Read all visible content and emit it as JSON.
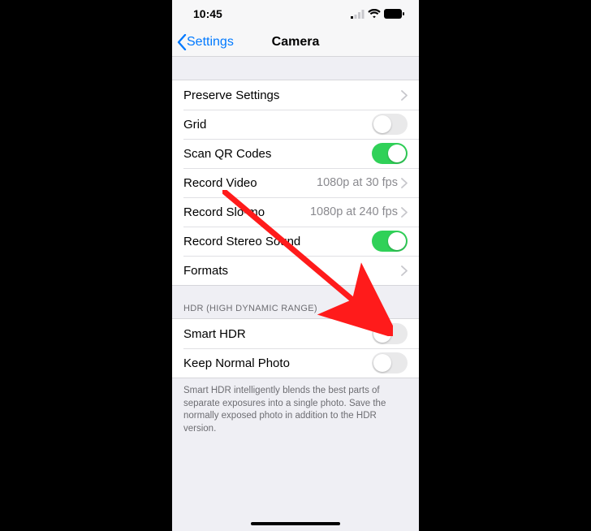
{
  "status": {
    "time": "10:45"
  },
  "nav": {
    "back_label": "Settings",
    "title": "Camera"
  },
  "group1": {
    "preserve_settings": "Preserve Settings",
    "grid": {
      "label": "Grid",
      "on": false
    },
    "scan_qr": {
      "label": "Scan QR Codes",
      "on": true
    },
    "record_video": {
      "label": "Record Video",
      "value": "1080p at 30 fps"
    },
    "record_slomo": {
      "label": "Record Slo-mo",
      "value": "1080p at 240 fps"
    },
    "record_stereo": {
      "label": "Record Stereo Sound",
      "on": true
    },
    "formats": "Formats"
  },
  "hdr": {
    "header": "HDR (HIGH DYNAMIC RANGE)",
    "smart_hdr": {
      "label": "Smart HDR",
      "on": false
    },
    "keep_normal": {
      "label": "Keep Normal Photo",
      "on": false
    },
    "footer": "Smart HDR intelligently blends the best parts of separate exposures into a single photo. Save the normally exposed photo in addition to the HDR version."
  }
}
